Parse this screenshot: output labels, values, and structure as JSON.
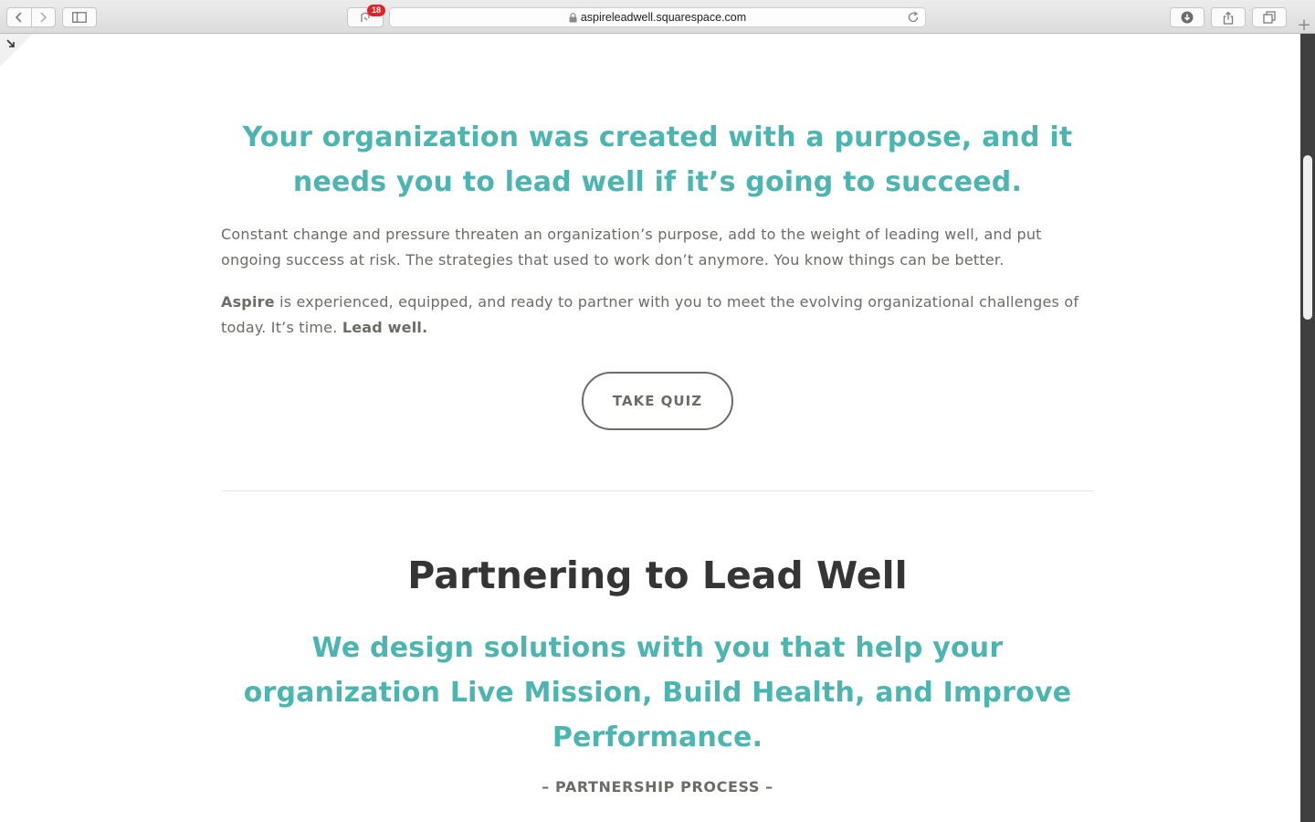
{
  "browser": {
    "url": "aspireleadwell.squarespace.com",
    "extension_badge": "18",
    "new_tab_label": "+"
  },
  "hero": {
    "headline": "Your organization was created with a purpose, and it needs you to lead well if it’s going to succeed.",
    "paragraph1": "Constant change and pressure threaten an organization’s purpose, add to the weight of leading well, and put ongoing success at risk. The strategies that used to work don’t anymore. You know things can be better.",
    "paragraph2_brand": "Aspire",
    "paragraph2_body": " is experienced, equipped, and ready to partner with you to meet the evolving organizational challenges of today. It’s time. ",
    "paragraph2_tagline": "Lead well.",
    "cta_label": "TAKE QUIZ"
  },
  "partnering": {
    "title": "Partnering to Lead Well",
    "subheadline": "We design solutions with you that help your organization Live Mission, Build Health, and Improve Performance.",
    "process_label": "– PARTNERSHIP PROCESS –"
  },
  "colors": {
    "accent_teal": "#4cb5b0",
    "body_text": "#6e6a66",
    "title_text": "#353535"
  }
}
